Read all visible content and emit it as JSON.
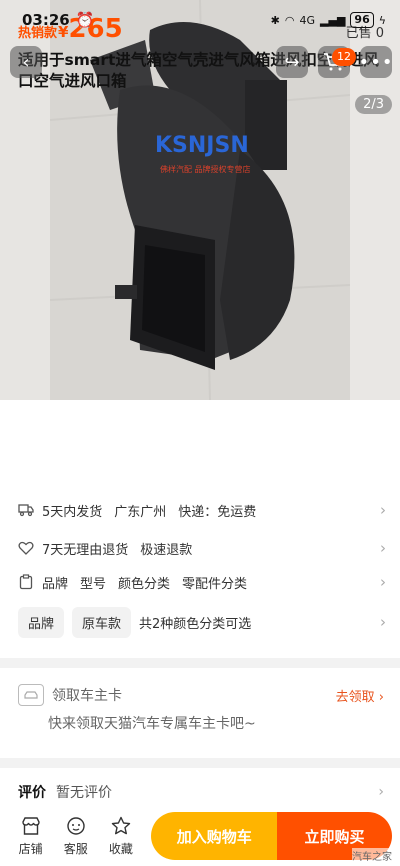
{
  "status": {
    "time": "03:26",
    "battery": "96",
    "network": "4G"
  },
  "topbar": {
    "cart_count": "12",
    "pager": "2/3"
  },
  "image": {
    "brand_text": "KSNJSN",
    "sub_text": "佛样汽配 品牌授权专营店"
  },
  "product": {
    "hot_label": "热销款",
    "currency": "¥",
    "price": "265",
    "sold": "已售 0",
    "title": "适用于smart进气箱空气壳进气风箱进风扣空调进风口空气进风口箱"
  },
  "shipping": {
    "dispatch": "5天内发货",
    "origin": "广东广州",
    "delivery": "快递：免运费"
  },
  "service": {
    "returns": "7天无理由退货",
    "refund": "极速退款"
  },
  "attributes": {
    "items": [
      "品牌",
      "型号",
      "颜色分类",
      "零配件分类"
    ]
  },
  "variants": {
    "tags": [
      "品牌",
      "原车款"
    ],
    "summary": "共2种颜色分类可选"
  },
  "coupon": {
    "title": "领取车主卡",
    "action": "去领取",
    "subtitle": "快来领取天猫汽车专属车主卡吧~"
  },
  "review": {
    "label": "评价",
    "empty": "暂无评价"
  },
  "bottom": {
    "store": "店铺",
    "service": "客服",
    "favorite": "收藏",
    "add_cart": "加入购物车",
    "buy_now": "立即购买",
    "watermark": "汽车之家"
  },
  "colors": {
    "accent": "#ff5000",
    "cart_button": "#ffb400"
  }
}
